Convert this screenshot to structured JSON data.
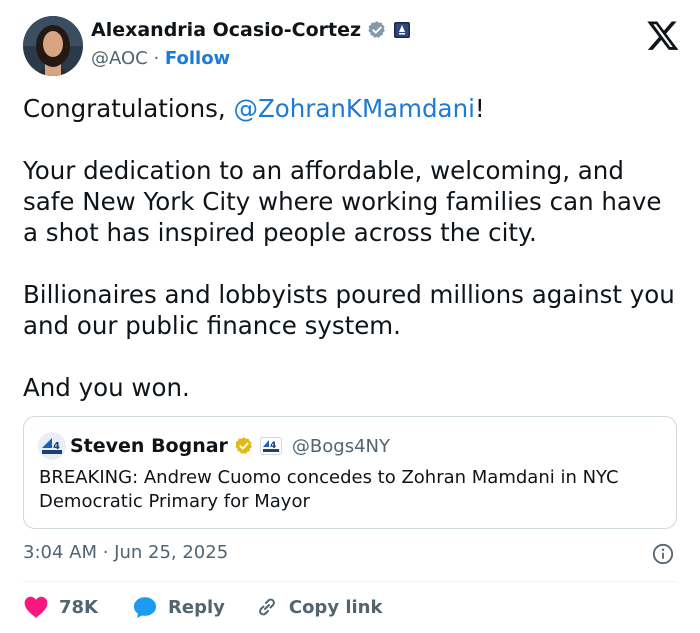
{
  "author": {
    "name": "Alexandria Ocasio-Cortez",
    "handle": "@AOC",
    "separator": "·",
    "follow_label": "Follow",
    "avatar_icon": "avatar-photo",
    "verified_icon": "verified-badge-icon",
    "affiliation_icon": "government-badge-icon"
  },
  "brand_icon": "x-logo-icon",
  "tweet": {
    "p1_prefix": "Congratulations, ",
    "p1_mention": "@ZohranKMamdani",
    "p1_suffix": "!",
    "p2": "Your dedication to an affordable, welcoming, and safe New York City where working families can have a shot has inspired people across the city.",
    "p3": "Billionaires and lobbyists poured millions against you and our public finance system.",
    "p4": "And you won."
  },
  "quote": {
    "name": "Steven Bognar",
    "handle": "@Bogs4NY",
    "text": "BREAKING: Andrew Cuomo concedes to Zohran Mamdani in NYC Democratic Primary for Mayor"
  },
  "meta": {
    "timestamp": "3:04 AM · Jun 25, 2025"
  },
  "actions": {
    "likes": "78K",
    "reply_label": "Reply",
    "copy_link_label": "Copy link"
  },
  "colors": {
    "link": "#1d7bd8",
    "muted": "#536471",
    "like": "#f91880",
    "verified_blue": "#829aab",
    "verified_gold": "#e2b719"
  }
}
